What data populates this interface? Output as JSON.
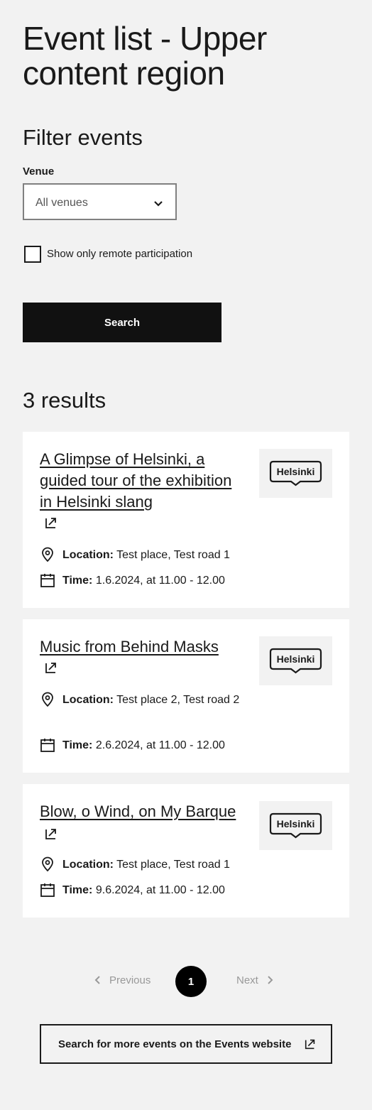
{
  "page": {
    "title": "Event list - Upper content region"
  },
  "filter": {
    "heading": "Filter events",
    "venue_label": "Venue",
    "venue_value": "All venues",
    "remote_label": "Show only remote participation",
    "remote_checked": false,
    "search_label": "Search"
  },
  "results": {
    "count_label": "3 results",
    "location_label": "Location:",
    "time_label": "Time:",
    "logo_text": "Helsinki",
    "items": [
      {
        "title": "A Glimpse of Helsinki, a guided tour of the exhibition in Helsinki slang",
        "location": "Test place, Test road 1",
        "time": "1.6.2024, at 11.00 - 12.00"
      },
      {
        "title": "Music from Behind Masks",
        "location": "Test place 2, Test road 2",
        "time": "2.6.2024, at 11.00 - 12.00"
      },
      {
        "title": "Blow, o Wind, on My Barque",
        "location": "Test place, Test road 1",
        "time": "9.6.2024, at 11.00 - 12.00"
      }
    ]
  },
  "pagination": {
    "previous_label": "Previous",
    "current_page": "1",
    "next_label": "Next"
  },
  "footer": {
    "more_events_label": "Search for more events on the Events website"
  }
}
